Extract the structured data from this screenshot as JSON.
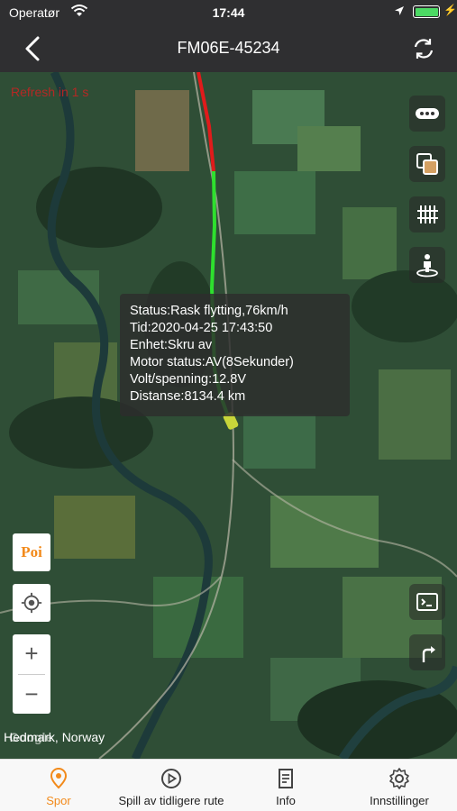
{
  "status_bar": {
    "carrier": "Operatør",
    "time": "17:44"
  },
  "nav": {
    "title": "FM06E-45234",
    "back_icon": "chevron-left-icon",
    "refresh_icon": "refresh-icon"
  },
  "map": {
    "refresh_label": "Refresh in 1 s",
    "attribution": "Hedmark, Norway",
    "google_mark": "Google",
    "right_buttons": [
      "more-icon",
      "layers-icon",
      "fence-icon",
      "street-view-icon"
    ],
    "bottom_right_buttons": [
      "console-icon",
      "direction-icon"
    ],
    "left_buttons": {
      "poi_label": "Poi",
      "locate_icon": "crosshair-icon",
      "zoom_in": "+",
      "zoom_out": "−"
    }
  },
  "vehicle_info": {
    "status": "Status:Rask flytting,76km/h",
    "time": "Tid:2020-04-25 17:43:50",
    "device": "Enhet:Skru av",
    "motor": "Motor status:AV(8Sekunder)",
    "voltage": "Volt/spenning:12.8V",
    "distance": "Distanse:8134.4 km"
  },
  "colors": {
    "accent": "#f28a1b",
    "track_fast": "#e01b1b",
    "track_normal": "#2ee02e",
    "top_bar": "#2f2f31"
  },
  "tabs": [
    {
      "label": "Spor",
      "icon": "location-pin-icon",
      "active": true
    },
    {
      "label": "Spill av tidligere rute",
      "icon": "play-circle-icon",
      "active": false
    },
    {
      "label": "Info",
      "icon": "document-icon",
      "active": false
    },
    {
      "label": "Innstillinger",
      "icon": "gear-icon",
      "active": false
    }
  ]
}
